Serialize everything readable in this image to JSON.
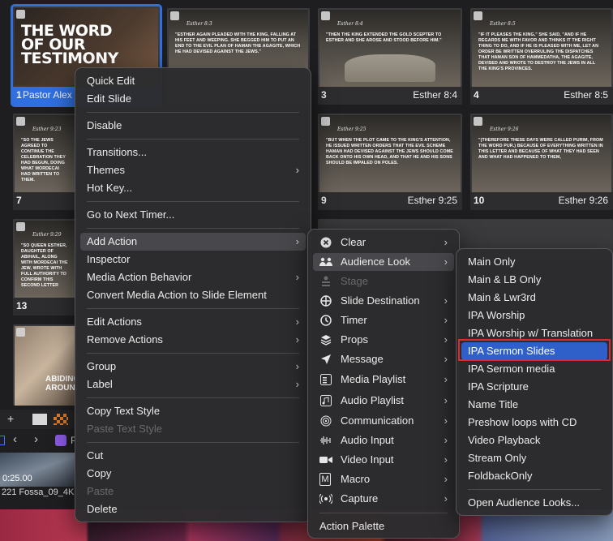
{
  "slides": [
    {
      "num": "1",
      "name": "Pastor Alex",
      "title": "THE WORD OF OUR TESTIMONY",
      "selected": true
    },
    {
      "num": "",
      "name": "",
      "ref": "Esther 8:3",
      "verse": "\"ESTHER AGAIN PLEADED WITH THE KING, FALLING AT HIS FEET AND WEEPING. SHE BEGGED HIM TO PUT AN END TO THE EVIL PLAN OF HAMAN THE AGAGITE, WHICH HE HAD DEVISED AGAINST THE JEWS.\""
    },
    {
      "num": "3",
      "name": "Esther 8:4",
      "ref": "Esther 8:4",
      "verse": "\"THEN THE KING EXTENDED THE GOLD SCEPTER TO ESTHER AND SHE AROSE AND STOOD BEFORE HIM.\""
    },
    {
      "num": "4",
      "name": "Esther 8:5",
      "ref": "Esther 8:5",
      "verse": "\"IF IT PLEASES THE KING,\" SHE SAID, \"AND IF HE REGARDS ME WITH FAVOR AND THINKS IT THE RIGHT THING TO DO, AND IF HE IS PLEASED WITH ME, LET AN ORDER BE WRITTEN OVERRULING THE DISPATCHES THAT HAMAN SON OF HAMMEDATHA, THE AGAGITE, DEVISED AND WROTE TO DESTROY THE JEWS IN ALL THE KING'S PROVINCES."
    },
    {
      "num": "7",
      "name": "",
      "ref": "Esther 9:23",
      "verse": "\"SO THE JEWS AGREED TO CONTINUE THE CELEBRATION THEY HAD BEGUN, DOING WHAT MORDECAI HAD WRITTEN TO THEM."
    },
    {
      "num": "9",
      "name": "Esther 9:25",
      "ref": "Esther 9:25",
      "verse": "\"BUT WHEN THE PLOT CAME TO THE KING'S ATTENTION, HE ISSUED WRITTEN ORDERS THAT THE EVIL SCHEME HAMAN HAD DEVISED AGAINST THE JEWS SHOULD COME BACK ONTO HIS OWN HEAD, AND THAT HE AND HIS SONS SHOULD BE IMPALED ON POLES."
    },
    {
      "num": "10",
      "name": "Esther 9:26",
      "ref": "Esther 9:26",
      "verse": "\"(THEREFORE THESE DAYS WERE CALLED PURIM, FROM THE WORD PUR.) BECAUSE OF EVERYTHING WRITTEN IN THIS LETTER AND BECAUSE OF WHAT THEY HAD SEEN AND WHAT HAD HAPPENED TO THEM,"
    },
    {
      "num": "13",
      "name": "",
      "ref": "Esther 9:29",
      "verse": "\"SO QUEEN ESTHER, DAUGHTER OF ABIHAIL, ALONG WITH MORDECAI THE JEW, WROTE WITH FULL AUTHORITY TO CONFIRM THIS SECOND LETTER"
    },
    {
      "num": "",
      "name": "",
      "title2": "ABIDING AROUND"
    }
  ],
  "media": {
    "time": "0:25.00",
    "name": "221  Fossa_09_4K"
  },
  "toolbar": {
    "add": "+",
    "p_label": "P"
  },
  "context_menu": {
    "items": [
      {
        "label": "Quick Edit"
      },
      {
        "label": "Edit Slide"
      },
      {
        "label": "Disable"
      },
      {
        "label": "Transitions..."
      },
      {
        "label": "Themes"
      },
      {
        "label": "Hot Key..."
      },
      {
        "label": "Go to Next Timer..."
      },
      {
        "label": "Add Action"
      },
      {
        "label": "Inspector"
      },
      {
        "label": "Media Action Behavior"
      },
      {
        "label": "Convert Media Action to Slide Element"
      },
      {
        "label": "Edit Actions"
      },
      {
        "label": "Remove Actions"
      },
      {
        "label": "Group"
      },
      {
        "label": "Label"
      },
      {
        "label": "Copy Text Style"
      },
      {
        "label": "Paste Text Style"
      },
      {
        "label": "Cut"
      },
      {
        "label": "Copy"
      },
      {
        "label": "Paste"
      },
      {
        "label": "Delete"
      }
    ]
  },
  "action_menu": {
    "items": [
      {
        "label": "Clear",
        "icon": "x-circle-icon"
      },
      {
        "label": "Audience Look",
        "icon": "audience-look-icon"
      },
      {
        "label": "Stage",
        "icon": "stage-icon"
      },
      {
        "label": "Slide Destination",
        "icon": "slide-destination-icon"
      },
      {
        "label": "Timer",
        "icon": "timer-icon"
      },
      {
        "label": "Props",
        "icon": "props-icon"
      },
      {
        "label": "Message",
        "icon": "message-icon"
      },
      {
        "label": "Media Playlist",
        "icon": "media-playlist-icon"
      },
      {
        "label": "Audio Playlist",
        "icon": "audio-playlist-icon"
      },
      {
        "label": "Communication",
        "icon": "communication-icon"
      },
      {
        "label": "Audio Input",
        "icon": "audio-input-icon"
      },
      {
        "label": "Video Input",
        "icon": "video-input-icon"
      },
      {
        "label": "Macro",
        "icon": "macro-icon"
      },
      {
        "label": "Capture",
        "icon": "capture-icon"
      },
      {
        "label": "Action Palette",
        "icon": ""
      }
    ]
  },
  "looks_menu": {
    "items": [
      {
        "label": "Main Only"
      },
      {
        "label": "Main & LB Only"
      },
      {
        "label": "Main & Lwr3rd"
      },
      {
        "label": "IPA Worship"
      },
      {
        "label": "IPA Worship w/ Translation"
      },
      {
        "label": "IPA Sermon Slides"
      },
      {
        "label": "IPA Sermon media"
      },
      {
        "label": "IPA Scripture"
      },
      {
        "label": "Name Title"
      },
      {
        "label": "Preshow loops with CD"
      },
      {
        "label": "Video Playback"
      },
      {
        "label": "Stream Only"
      },
      {
        "label": "FoldbackOnly"
      },
      {
        "label": "Open Audience Looks..."
      }
    ]
  }
}
